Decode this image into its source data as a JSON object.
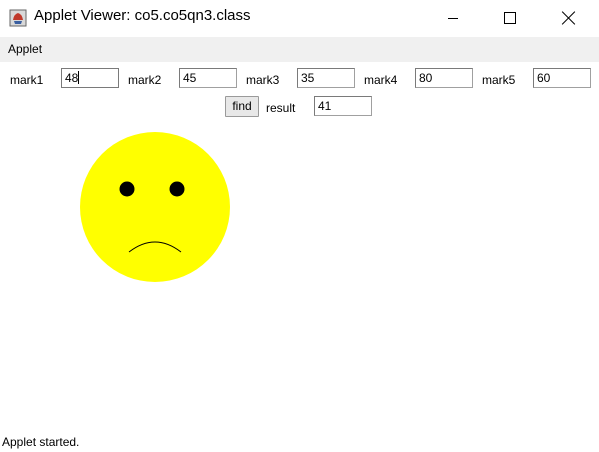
{
  "window": {
    "title": "Applet Viewer: co5.co5qn3.class"
  },
  "menubar": {
    "items": [
      "Applet"
    ]
  },
  "form": {
    "fields": [
      {
        "label": "mark1",
        "value": "48"
      },
      {
        "label": "mark2",
        "value": "45"
      },
      {
        "label": "mark3",
        "value": "35"
      },
      {
        "label": "mark4",
        "value": "80"
      },
      {
        "label": "mark5",
        "value": "60"
      }
    ],
    "find_label": "find",
    "result_label": "result",
    "result_value": "41"
  },
  "face": {
    "expression": "sad",
    "face_color": "#ffff00",
    "eye_color": "#000000"
  },
  "status": {
    "text": "Applet started."
  }
}
